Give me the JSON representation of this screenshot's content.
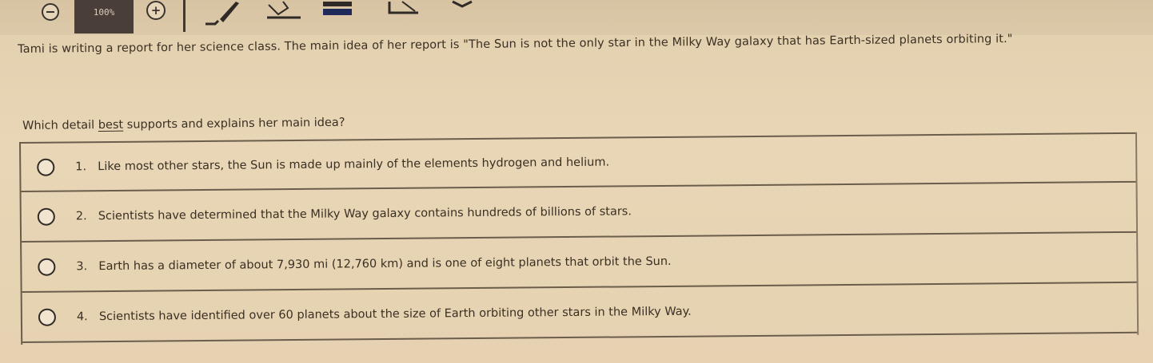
{
  "toolbar": {
    "zoom_out_icon": "zoom-out-icon",
    "zoom_level": "100%",
    "zoom_in_icon": "zoom-in-icon",
    "tools": [
      "pen-icon",
      "highlighter-icon",
      "answer-masking-icon",
      "line-reader-icon",
      "chevron-icon"
    ]
  },
  "passage": {
    "text": "Tami is writing a report for her science class. The main idea of her report is \"The Sun is not the only star in the Milky Way galaxy that has Earth-sized planets orbiting it.\""
  },
  "question": {
    "prefix": "Which detail ",
    "emphasis": "best",
    "suffix": " supports and explains her main idea?"
  },
  "choices": [
    {
      "number": "1.",
      "text": "Like most other stars, the Sun is made up mainly of the elements hydrogen and helium."
    },
    {
      "number": "2.",
      "text": "Scientists have determined that the Milky Way galaxy contains hundreds of billions of stars."
    },
    {
      "number": "3.",
      "text": "Earth has a diameter of about 7,930 mi (12,760 km) and is one of eight planets that orbit the Sun."
    },
    {
      "number": "4.",
      "text": "Scientists have identified over 60 planets about the size of Earth orbiting other stars in the Milky Way."
    }
  ]
}
